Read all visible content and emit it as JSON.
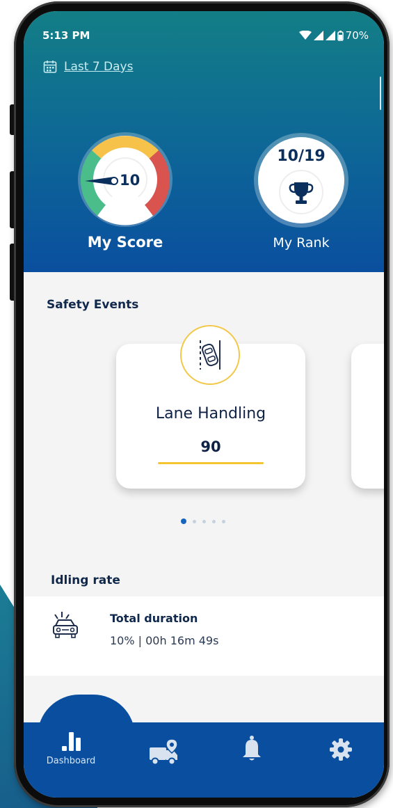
{
  "status": {
    "time": "5:13 PM",
    "battery": "70%"
  },
  "header": {
    "period_label": "Last 7 Days"
  },
  "score": {
    "value": "10",
    "label": "My Score"
  },
  "rank": {
    "value": "10/19",
    "label": "My Rank"
  },
  "safety_events": {
    "title": "Safety Events",
    "cards": [
      {
        "name": "Lane Handling",
        "value": "90",
        "icon": "lane-change-car-icon"
      }
    ],
    "pagination": {
      "total": 5,
      "active": 0
    }
  },
  "idling": {
    "title": "Idling rate",
    "row": {
      "title": "Total duration",
      "detail": "10% | 00h 16m 49s",
      "icon": "idling-car-icon"
    }
  },
  "nav": {
    "items": [
      {
        "label": "Dashboard",
        "icon": "bar-chart-icon",
        "active": true
      },
      {
        "label": "",
        "icon": "truck-location-icon"
      },
      {
        "label": "",
        "icon": "bell-icon"
      },
      {
        "label": "",
        "icon": "gear-icon"
      }
    ]
  },
  "colors": {
    "header_top": "#137e86",
    "header_bottom": "#0a4f9f",
    "gauge_green": "#4bbd8b",
    "gauge_yellow": "#f6c24a",
    "gauge_red": "#d9534f",
    "accent_yellow": "#f4c531",
    "text_dark": "#10284c"
  }
}
